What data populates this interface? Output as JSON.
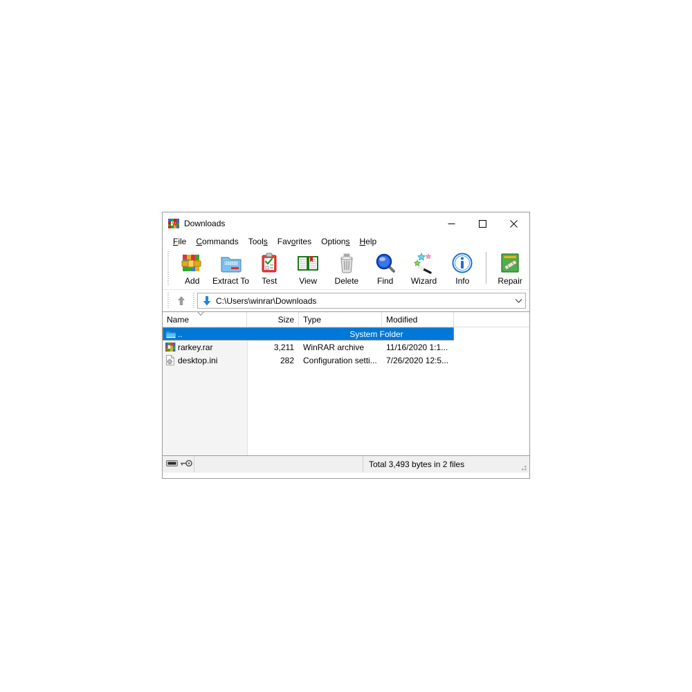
{
  "window": {
    "title": "Downloads",
    "app_icon": "winrar-books-icon",
    "caption": {
      "minimize": "minimize-icon",
      "maximize": "maximize-icon",
      "close": "close-icon"
    }
  },
  "menubar": {
    "items": [
      {
        "label": "File",
        "accel_index": 0
      },
      {
        "label": "Commands",
        "accel_index": 0
      },
      {
        "label": "Tools",
        "accel_index": 4
      },
      {
        "label": "Favorites",
        "accel_index": 3
      },
      {
        "label": "Options",
        "accel_index": 5
      },
      {
        "label": "Help",
        "accel_index": 0
      }
    ]
  },
  "toolbar": {
    "buttons": [
      {
        "label": "Add",
        "icon": "add-archive-icon"
      },
      {
        "label": "Extract To",
        "icon": "extract-folder-icon"
      },
      {
        "label": "Test",
        "icon": "test-clipboard-icon"
      },
      {
        "label": "View",
        "icon": "view-book-icon"
      },
      {
        "label": "Delete",
        "icon": "delete-trash-icon"
      },
      {
        "label": "Find",
        "icon": "find-magnifier-icon"
      },
      {
        "label": "Wizard",
        "icon": "wizard-wand-icon"
      },
      {
        "label": "Info",
        "icon": "info-circle-icon"
      },
      {
        "label": "Repair",
        "icon": "repair-icon"
      }
    ]
  },
  "addressbar": {
    "up_icon": "up-arrow-icon",
    "folder_icon": "downloads-arrow-icon",
    "path": "C:\\Users\\winrar\\Downloads",
    "dropdown_icon": "chevron-down-icon"
  },
  "filelist": {
    "columns": [
      {
        "key": "name",
        "label": "Name",
        "align": "left",
        "sorted": true
      },
      {
        "key": "size",
        "label": "Size",
        "align": "right"
      },
      {
        "key": "type",
        "label": "Type",
        "align": "left"
      },
      {
        "key": "modified",
        "label": "Modified",
        "align": "left"
      }
    ],
    "sort_indicator_icon": "sort-descending-chevron-icon",
    "rows": [
      {
        "icon": "folder-up-icon",
        "name": "..",
        "size": "",
        "type": "System Folder",
        "modified": "",
        "selected": true
      },
      {
        "icon": "rar-archive-icon",
        "name": "rarkey.rar",
        "size": "3,211",
        "type": "WinRAR archive",
        "modified": "11/16/2020 1:1...",
        "selected": false
      },
      {
        "icon": "ini-config-icon",
        "name": "desktop.ini",
        "size": "282",
        "type": "Configuration setti...",
        "modified": "7/26/2020 12:5...",
        "selected": false
      }
    ]
  },
  "statusbar": {
    "disk_icon": "disk-drive-icon",
    "key_icon": "key-icon",
    "total": "Total 3,493 bytes in 2 files",
    "resize_grip_icon": "resize-grip-icon"
  },
  "colors": {
    "selection": "#0078d7",
    "window_border": "#9a9a9a",
    "statusbar_bg": "#f0f0f0",
    "name_column_bg": "#f4f4f4"
  }
}
